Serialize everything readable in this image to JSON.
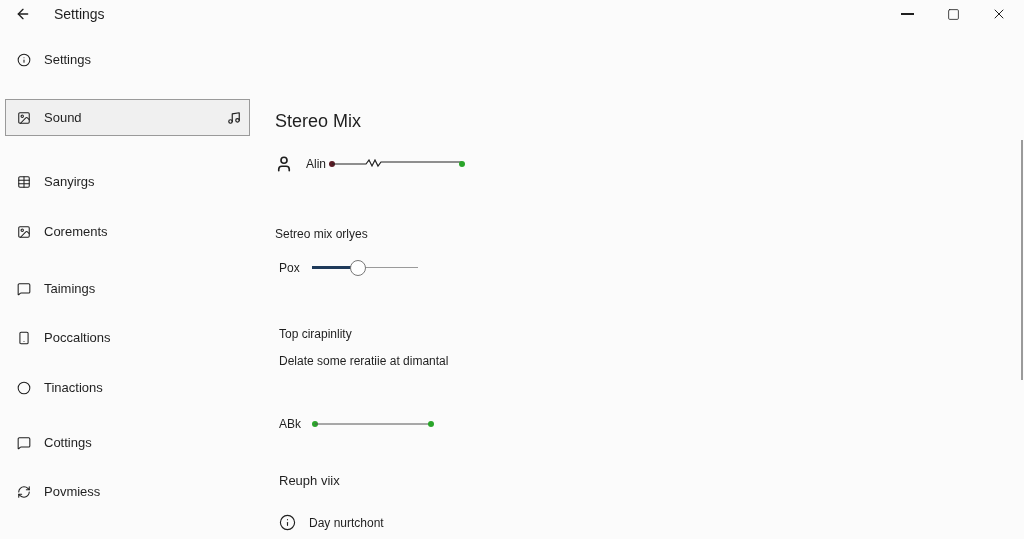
{
  "window": {
    "title": "Settings"
  },
  "sidebar": {
    "items": [
      {
        "label": "Settings",
        "selected": false
      },
      {
        "label": "Sound",
        "selected": true
      },
      {
        "label": "Sanyirgs",
        "selected": false
      },
      {
        "label": "Corements",
        "selected": false
      },
      {
        "label": "Taimings",
        "selected": false
      },
      {
        "label": "Poccaltions",
        "selected": false
      },
      {
        "label": "Tinactions",
        "selected": false
      },
      {
        "label": "Cottings",
        "selected": false
      },
      {
        "label": "Povmiess",
        "selected": false
      }
    ]
  },
  "content": {
    "title": "Stereo Mix",
    "device": {
      "label": "Alin"
    },
    "options_heading": "Setreo mix orlyes",
    "slider": {
      "label": "Pox",
      "level": 0.43
    },
    "capability": {
      "title": "Top cirapinlity",
      "description": "Delate some reratiie at dimantal"
    },
    "link": {
      "label": "ABk"
    },
    "section": "Reuph viix",
    "info": {
      "label": "Day nurtchont"
    }
  }
}
